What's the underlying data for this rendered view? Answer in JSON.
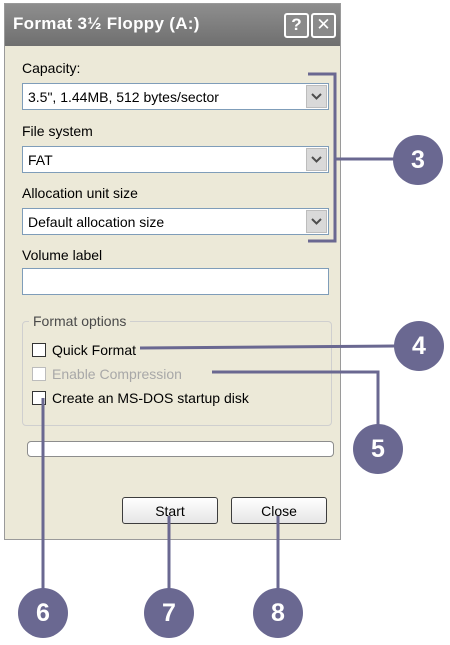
{
  "window": {
    "title": "Format 3½ Floppy (A:)",
    "help_glyph": "?",
    "close_glyph": "✕"
  },
  "capacity": {
    "label": "Capacity:",
    "value": "3.5\",  1.44MB, 512 bytes/sector"
  },
  "file_system": {
    "label": "File system",
    "value": "FAT"
  },
  "allocation": {
    "label": "Allocation unit size",
    "value": "Default allocation size"
  },
  "volume_label": {
    "label": "Volume label",
    "value": ""
  },
  "format_options": {
    "title": "Format options",
    "quick_format": {
      "label": "Quick Format",
      "checked": false,
      "enabled": true
    },
    "enable_compression": {
      "label": "Enable Compression",
      "checked": false,
      "enabled": false
    },
    "msdos_startup": {
      "label": "Create an MS-DOS startup disk",
      "checked": false,
      "enabled": true
    }
  },
  "progress": {
    "value": 0
  },
  "buttons": {
    "start": "Start",
    "close": "Close"
  },
  "callouts": {
    "c3": "3",
    "c4": "4",
    "c5": "5",
    "c6": "6",
    "c7": "7",
    "c8": "8"
  },
  "colors": {
    "callout": "#6a6891",
    "titlebar": "#7f7f7f",
    "dialog_bg": "#ece9d8"
  }
}
